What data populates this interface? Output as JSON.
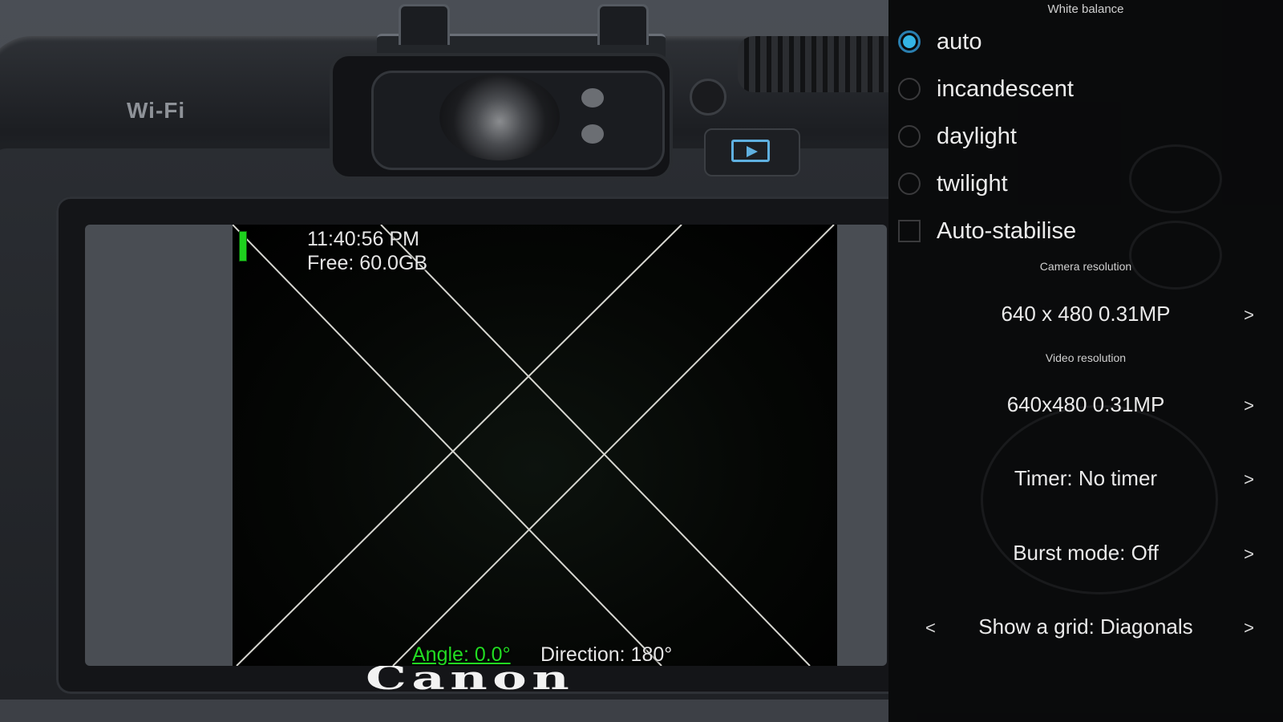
{
  "camera_body": {
    "wifi_label": "Wi-Fi",
    "brand_logo": "Canon"
  },
  "preview": {
    "time": "11:40:56 PM",
    "free_space": "Free: 60.0GB",
    "angle": "Angle: 0.0°",
    "direction": "Direction: 180°",
    "grid_mode": "Diagonals"
  },
  "panel": {
    "white_balance": {
      "header": "White balance",
      "options": [
        {
          "label": "auto",
          "selected": true
        },
        {
          "label": "incandescent",
          "selected": false
        },
        {
          "label": "daylight",
          "selected": false
        },
        {
          "label": "twilight",
          "selected": false
        }
      ]
    },
    "auto_stabilise": {
      "label": "Auto-stabilise",
      "checked": false
    },
    "camera_resolution": {
      "header": "Camera resolution",
      "value": "640 x 480 0.31MP",
      "arrow": ">"
    },
    "video_resolution": {
      "header": "Video resolution",
      "value": "640x480 0.31MP",
      "arrow": ">"
    },
    "timer": {
      "label": "Timer: No timer",
      "arrow": ">"
    },
    "burst": {
      "label": "Burst mode: Off",
      "arrow": ">"
    },
    "grid": {
      "label": "Show a grid: Diagonals",
      "prev_arrow": "<",
      "next_arrow": ">"
    }
  },
  "colors": {
    "accent": "#34b5e5",
    "angle_green": "#22dd22",
    "level_green": "#1ed11e",
    "panel_bg": "#080809"
  }
}
